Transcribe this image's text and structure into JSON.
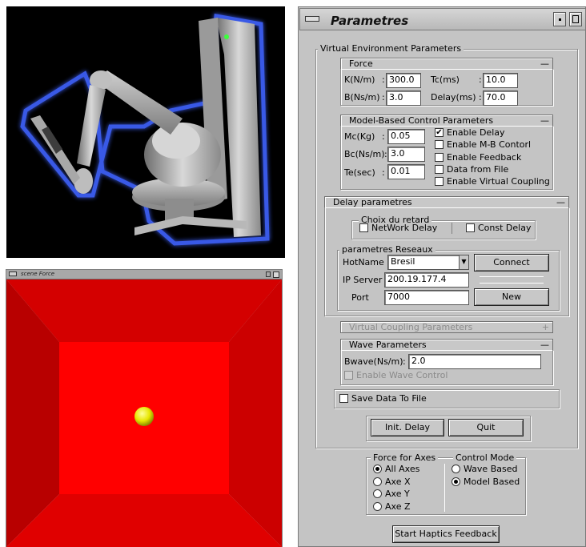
{
  "scene_window": {
    "title": "scene Force"
  },
  "param_window": {
    "title": "Parametres"
  },
  "virtual_env": {
    "title": "Virtual Environment Parameters",
    "force": {
      "title": "Force",
      "k_label": "K(N/m)",
      "k_value": "300.0",
      "tc_label": "Tc(ms)",
      "tc_value": "10.0",
      "b_label": "B(Ns/m)",
      "b_value": "3.0",
      "delay_label": "Delay(ms)",
      "delay_value": "70.0"
    },
    "model_based": {
      "title": "Model-Based Control Parameters",
      "mc_label": "Mc(Kg)",
      "mc_value": "0.05",
      "bc_label": "Bc(Ns/m)",
      "bc_value": "3.0",
      "te_label": "Te(sec)",
      "te_value": "0.01",
      "checks": [
        {
          "label": "Enable Delay",
          "checked": true
        },
        {
          "label": "Enable M-B Contorl",
          "checked": false
        },
        {
          "label": "Enable Feedback",
          "checked": false
        },
        {
          "label": "Data from File",
          "checked": false
        },
        {
          "label": "Enable Virtual Coupling",
          "checked": false
        }
      ]
    },
    "delay": {
      "title": "Delay parametres",
      "choix_title": "Choix du retard",
      "network_delay": "NetWork Delay",
      "const_delay": "Const Delay",
      "reseau_title": "parametres Reseaux",
      "hotname_label": "HotName",
      "hotname_value": "Bresil",
      "ip_label": "IP Server",
      "ip_value": "200.19.177.4",
      "port_label": "Port",
      "port_value": "7000",
      "connect": "Connect",
      "new": "New"
    },
    "virtual_coupling": {
      "title": "Virtual Coupling Parameters"
    },
    "wave": {
      "title": "Wave  Parameters",
      "bwave_label": "Bwave(Ns/m)",
      "bwave_value": "2.0",
      "enable_wave": "Enable Wave Control"
    },
    "save_data": "Save Data To File",
    "init_delay": "Init. Delay",
    "quit": "Quit"
  },
  "force_axes": {
    "title": "Force for Axes",
    "options": [
      "All Axes",
      "Axe X",
      "Axe Y",
      "Axe Z"
    ],
    "selected": "All Axes"
  },
  "control_mode": {
    "title": "Control Mode",
    "options": [
      "Wave Based",
      "Model Based"
    ],
    "selected": "Model Based"
  },
  "start_button": "Start Haptics Feedback",
  "colors": {
    "window_bg": "#c4c4c4",
    "scene_red": "#ff0000",
    "sphere": "#e6e600",
    "robot_glow": "#3a5bff"
  }
}
